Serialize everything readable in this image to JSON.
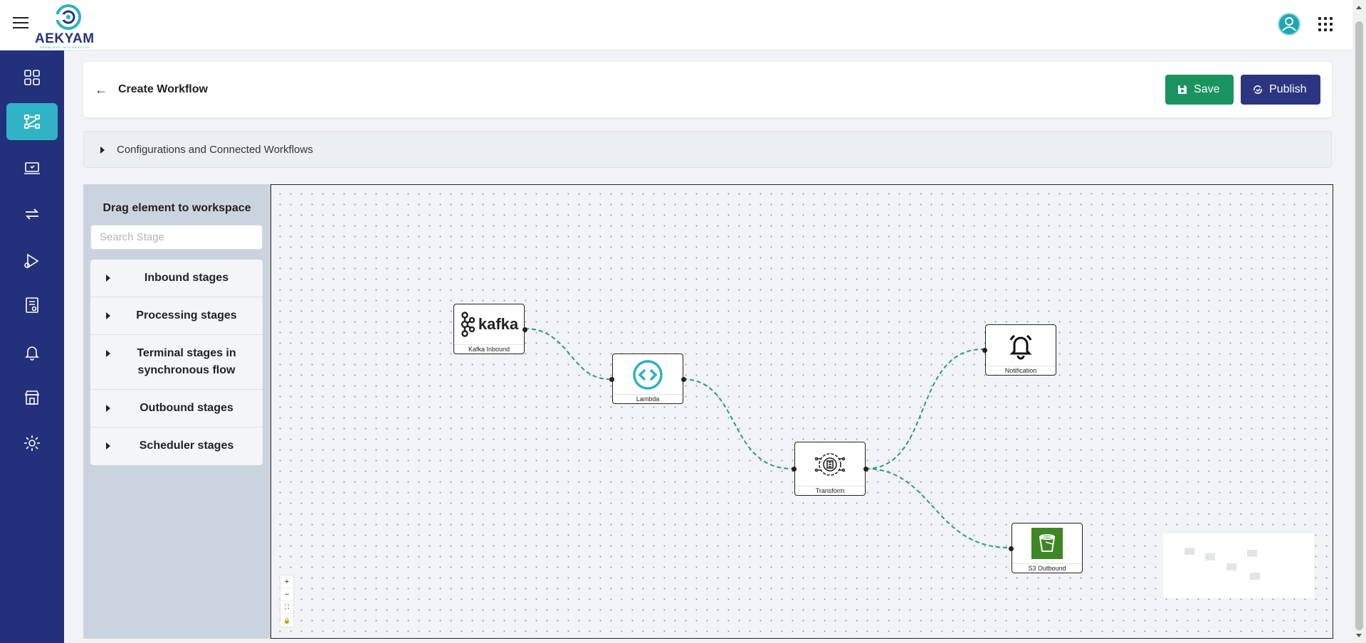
{
  "app": {
    "brand": "AEKYAM",
    "brand_tagline": "SEAMLESS INTEGRATION"
  },
  "topbar": {
    "menu_icon": "hamburger-icon",
    "profile_icon": "user-avatar-icon",
    "apps_icon": "apps-grid-icon"
  },
  "sidebar": {
    "items": [
      {
        "icon": "dashboard-grid-icon",
        "active": false
      },
      {
        "icon": "workflow-icon",
        "active": true
      },
      {
        "icon": "monitor-icon",
        "active": false
      },
      {
        "icon": "sync-icon",
        "active": false
      },
      {
        "icon": "run-icon",
        "active": false
      },
      {
        "icon": "report-icon",
        "active": false
      },
      {
        "icon": "bell-icon",
        "active": false
      },
      {
        "icon": "store-icon",
        "active": false
      },
      {
        "icon": "gear-icon",
        "active": false
      }
    ],
    "accent": "#31b3c6",
    "background": "#23307b"
  },
  "header": {
    "title": "Create Workflow",
    "save_label": "Save",
    "publish_label": "Publish",
    "save_color": "#1a9360",
    "publish_color": "#2c3582"
  },
  "config": {
    "label": "Configurations and Connected Workflows"
  },
  "palette": {
    "title": "Drag element to workspace",
    "search_placeholder": "Search Stage",
    "stages": [
      {
        "label": "Inbound stages"
      },
      {
        "label": "Processing stages"
      },
      {
        "label": "Terminal stages in synchronous flow"
      },
      {
        "label": "Outbound stages"
      },
      {
        "label": "Scheduler stages"
      }
    ]
  },
  "canvas": {
    "nodes": [
      {
        "id": "kafka",
        "label": "Kafka Inbound",
        "logo_text": "kafka"
      },
      {
        "id": "lambda",
        "label": "Lambda"
      },
      {
        "id": "transform",
        "label": "Transform"
      },
      {
        "id": "notification",
        "label": "Notification"
      },
      {
        "id": "s3",
        "label": "S3 Outbound"
      }
    ],
    "edges": [
      [
        "kafka",
        "lambda"
      ],
      [
        "lambda",
        "transform"
      ],
      [
        "transform",
        "notification"
      ],
      [
        "transform",
        "s3"
      ]
    ],
    "edge_color": "#2a9d7e",
    "controls": [
      "+",
      "−",
      "⛶",
      "🔒"
    ]
  }
}
